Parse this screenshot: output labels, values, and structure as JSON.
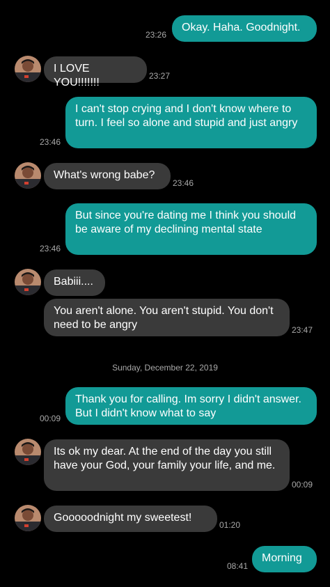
{
  "colors": {
    "background": "#000000",
    "sent_bubble": "#129a96",
    "received_bubble": "#3a3a3a",
    "timestamp": "#a9a9a9"
  },
  "messages": [
    {
      "direction": "sent",
      "text": "Okay. Haha. Goodnight.",
      "time": "23:26"
    },
    {
      "direction": "received",
      "text": "I LOVE YOU!!!!!!!",
      "time": "23:27"
    },
    {
      "direction": "sent",
      "text": "I can't stop crying and I don't know where to turn. I feel so alone and stupid and just angry",
      "time": "23:46"
    },
    {
      "direction": "received",
      "text": "What's wrong babe?",
      "time": "23:46"
    },
    {
      "direction": "sent",
      "text": "But since you're dating me I think you should be aware of my declining mental state",
      "time": "23:46"
    },
    {
      "direction": "received",
      "text": "Babiii....",
      "time": ""
    },
    {
      "direction": "received",
      "text": "You aren't alone. You aren't stupid. You don't need to be angry",
      "time": "23:47"
    },
    {
      "direction": "sent",
      "text": "Thank you for calling. Im sorry I didn't answer. But I didn't know what to say",
      "time": "00:09"
    },
    {
      "direction": "received",
      "text": "Its ok my dear. At the end of the day you still have your God, your family your life, and me.",
      "time": "00:09"
    },
    {
      "direction": "received",
      "text": "Gooooodnight my sweetest!",
      "time": "01:20"
    },
    {
      "direction": "sent",
      "text": "Morning",
      "time": "08:41"
    }
  ],
  "date_separator": "Sunday, December 22, 2019"
}
